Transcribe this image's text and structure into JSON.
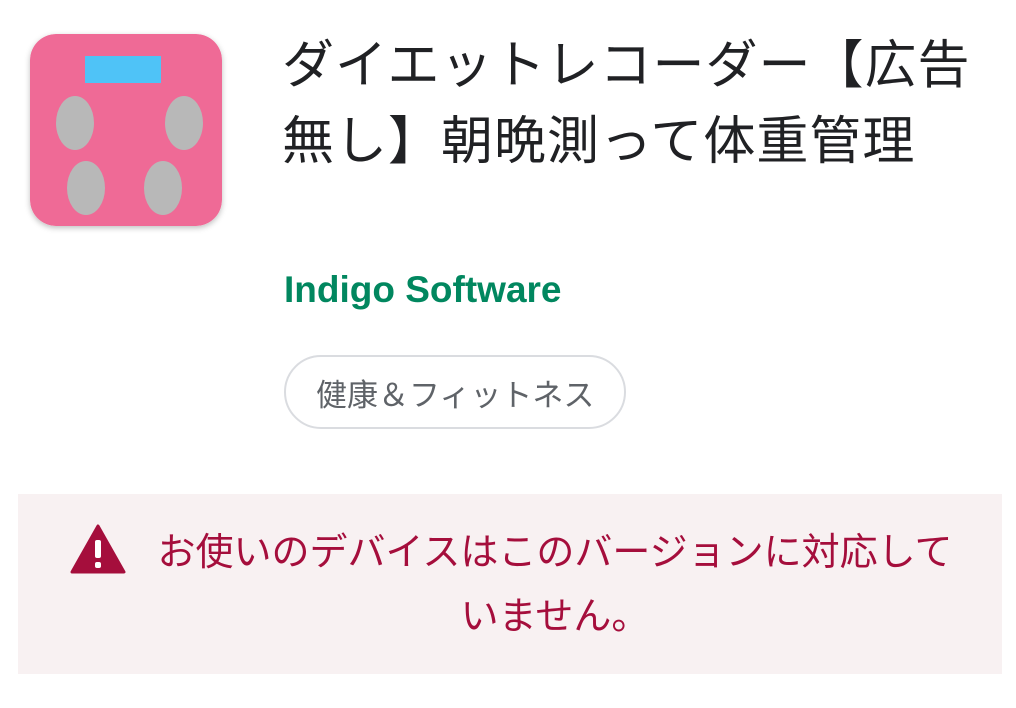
{
  "app": {
    "title": "ダイエットレコーダー【広告無し】朝晩測って体重管理",
    "developer": "Indigo Software",
    "category": "健康＆フィットネス",
    "icon": "bathroom-scale-icon"
  },
  "warning": {
    "icon": "warning-triangle-icon",
    "message": "お使いのデバイスはこのバージョンに対応していません。"
  },
  "colors": {
    "icon_background": "#ef6a96",
    "icon_display": "#4fc3f7",
    "icon_footpads": "#b8b8b8",
    "developer": "#01875f",
    "warning_text": "#a50e3c",
    "warning_background": "#f8f1f2",
    "chip_border": "#dadce0"
  }
}
